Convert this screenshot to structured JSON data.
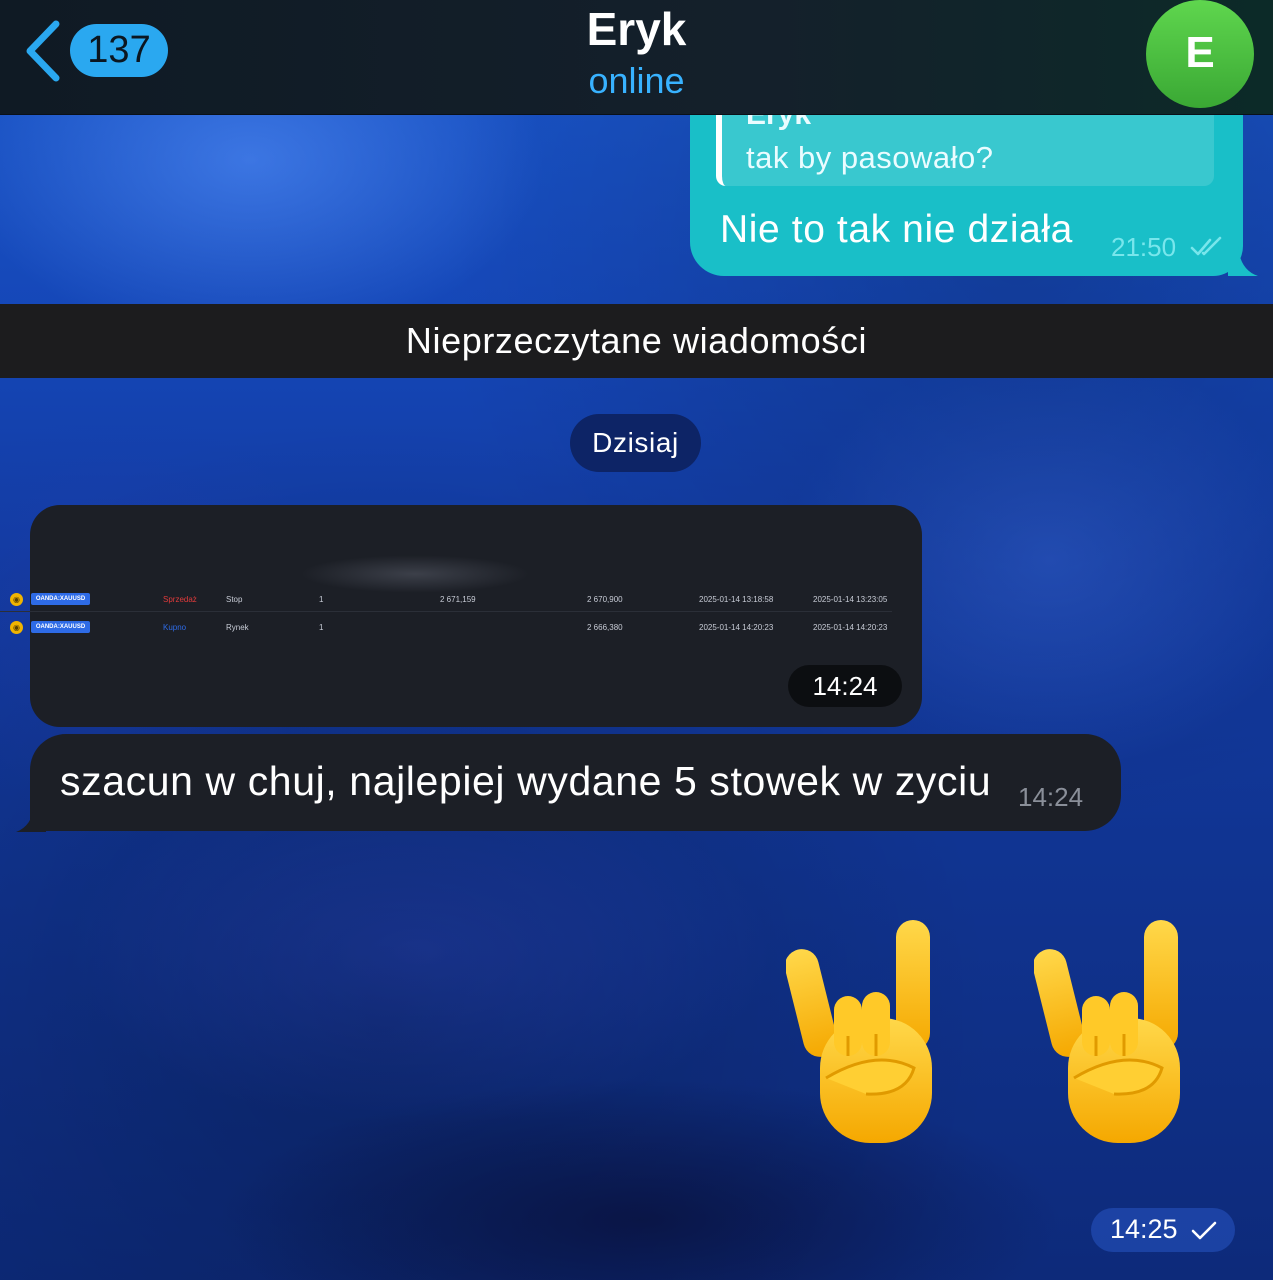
{
  "header": {
    "back_icon": "chevron-left-icon",
    "unread_count": "137",
    "title": "Eryk",
    "status": "online",
    "avatar_letter": "E",
    "accent": "#38b2ff",
    "avatar_color": "#4cc443"
  },
  "messages": {
    "outgoing_reply": {
      "quoted_author": "Eryk",
      "quoted_text": "tak by pasowało?",
      "text": "Nie to tak nie działa",
      "time": "21:50",
      "status_icon": "double-check-icon",
      "bubble_color": "#19bfc8"
    },
    "unread_divider": "Nieprzeczytane wiadomości",
    "date_pill": "Dzisiaj",
    "image_message": {
      "time": "14:24",
      "rows": [
        {
          "icon": "gold-coin-icon",
          "symbol": "OANDA:XAUUSD",
          "side": "Sprzedaż",
          "type": "Stop",
          "qty": "1",
          "price1": "2 671,159",
          "price2": "2 670,900",
          "opened": "2025-01-14 13:18:58",
          "closed": "2025-01-14 13:23:05"
        },
        {
          "icon": "gold-coin-icon",
          "symbol": "OANDA:XAUUSD",
          "side": "Kupno",
          "type": "Rynek",
          "qty": "1",
          "price1": "",
          "price2": "2 666,380",
          "opened": "2025-01-14 14:20:23",
          "closed": "2025-01-14 14:20:23"
        }
      ]
    },
    "incoming_text": {
      "text": "szacun w chuj, najlepiej wydane 5 stowek w zyciu",
      "time": "14:24"
    },
    "emoji_message": {
      "emoji": [
        "🤘",
        "🤘"
      ],
      "emoji_icon": "sign-of-the-horns-icon",
      "time": "14:25",
      "status_icon": "single-check-icon"
    }
  }
}
